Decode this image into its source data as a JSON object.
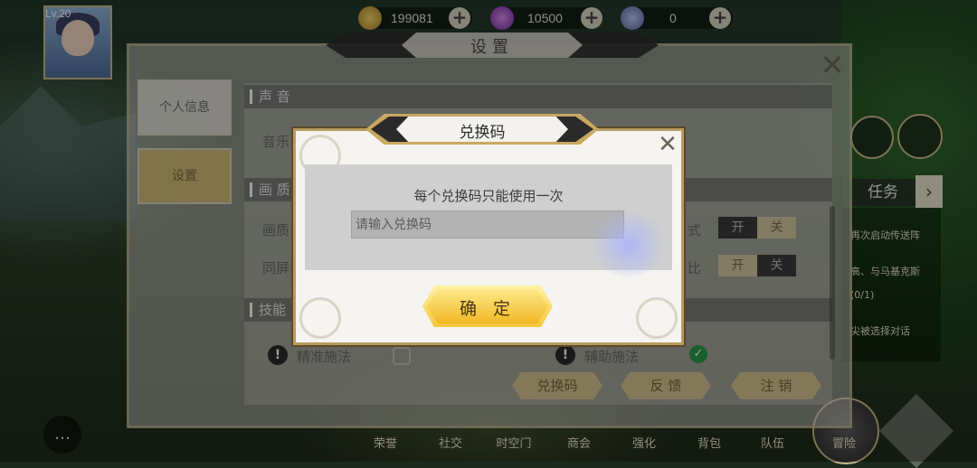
{
  "player": {
    "level": "Lv.20"
  },
  "currency": {
    "gold": "199081",
    "gems": "10500",
    "tokens": "0",
    "add_label": "+"
  },
  "settings": {
    "title": "设置",
    "tabs": [
      {
        "label": "个人信息"
      },
      {
        "label": "设置"
      }
    ],
    "sections": {
      "sound": "声 音",
      "graphics": "画 质",
      "skill": "技能"
    },
    "rows": {
      "music": "音乐",
      "quality": "画质",
      "same_screen": "同屏",
      "mode_suffix": "式",
      "mode_suffix2": "比"
    },
    "toggles": {
      "on": "开",
      "off": "关"
    },
    "skill_options": {
      "precise": "精准施法",
      "assist": "辅助施法"
    },
    "buttons": {
      "redeem": "兑换码",
      "feedback": "反 馈",
      "logout": "注 销"
    }
  },
  "right_panel": {
    "task": "任务",
    "quest_lines": [
      "再次启动传送阵",
      "高、与马基克斯",
      "(0/1)",
      "尖被选择对话"
    ]
  },
  "bottom_menu": {
    "items": [
      "荣誉",
      "社交",
      "时空门",
      "商会",
      "强化",
      "背包",
      "队伍"
    ],
    "adventure": "冒险"
  },
  "dialog": {
    "title": "兑换码",
    "hint": "每个兑换码只能使用一次",
    "input_placeholder": "请输入兑换码",
    "confirm": "确 定"
  },
  "colors": {
    "accent_gold": "#f5c63a",
    "dialog_border": "#b89b5e",
    "checked_green": "#2a9a4a"
  }
}
